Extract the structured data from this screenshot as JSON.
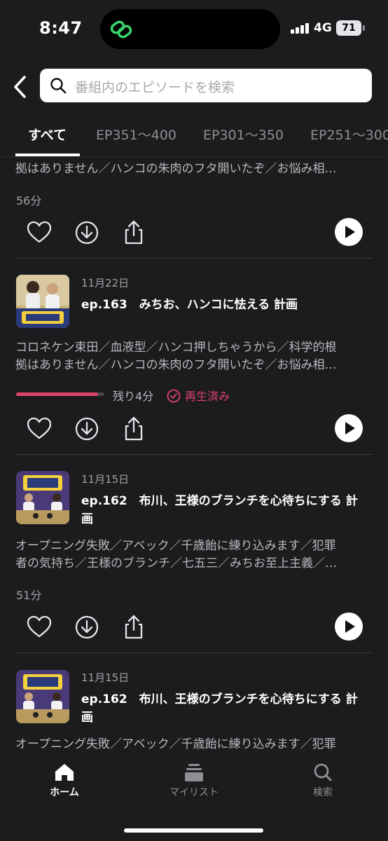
{
  "status_bar": {
    "time": "8:47",
    "network": "4G",
    "battery": "71"
  },
  "search": {
    "placeholder": "番組内のエピソードを検索"
  },
  "tabs": [
    {
      "label": "すべて",
      "active": true
    },
    {
      "label": "EP351〜400"
    },
    {
      "label": "EP301〜350"
    },
    {
      "label": "EP251〜300"
    }
  ],
  "episodes": [
    {
      "description": "拠はありません／ハンコの朱肉のフタ開いたぞ／お悩み相…",
      "duration": "56分"
    },
    {
      "date": "11月22日",
      "title": "ep.163　みちお、ハンコに怯える 計画",
      "description": "コロネケン束田／血液型／ハンコ押しちゃうから／科学的根\n拠はありません／ハンコの朱肉のフタ開いたぞ／お悩み相…",
      "progress": 0.93,
      "remaining": "残り4分",
      "played": "再生済み"
    },
    {
      "date": "11月15日",
      "title": "ep.162　布川、王様のブランチを心待ちにする 計\n画",
      "description": "オープニング失敗／アベック／千歳飴に練り込みます／犯罪\n者の気持ち／王様のブランチ／七五三／みちお至上主義／…",
      "duration": "51分"
    },
    {
      "date": "11月15日",
      "title": "ep.162　布川、王様のブランチを心待ちにする 計\n画",
      "description": "オープニング失敗／アベック／千歳飴に練り込みます／犯罪"
    }
  ],
  "nav": [
    {
      "label": "ホーム",
      "icon": "home-icon",
      "active": true
    },
    {
      "label": "マイリスト",
      "icon": "mylist-icon"
    },
    {
      "label": "検索",
      "icon": "search-icon"
    }
  ],
  "colors": {
    "background": "#1c1c1e",
    "accent": "#e0426e"
  }
}
